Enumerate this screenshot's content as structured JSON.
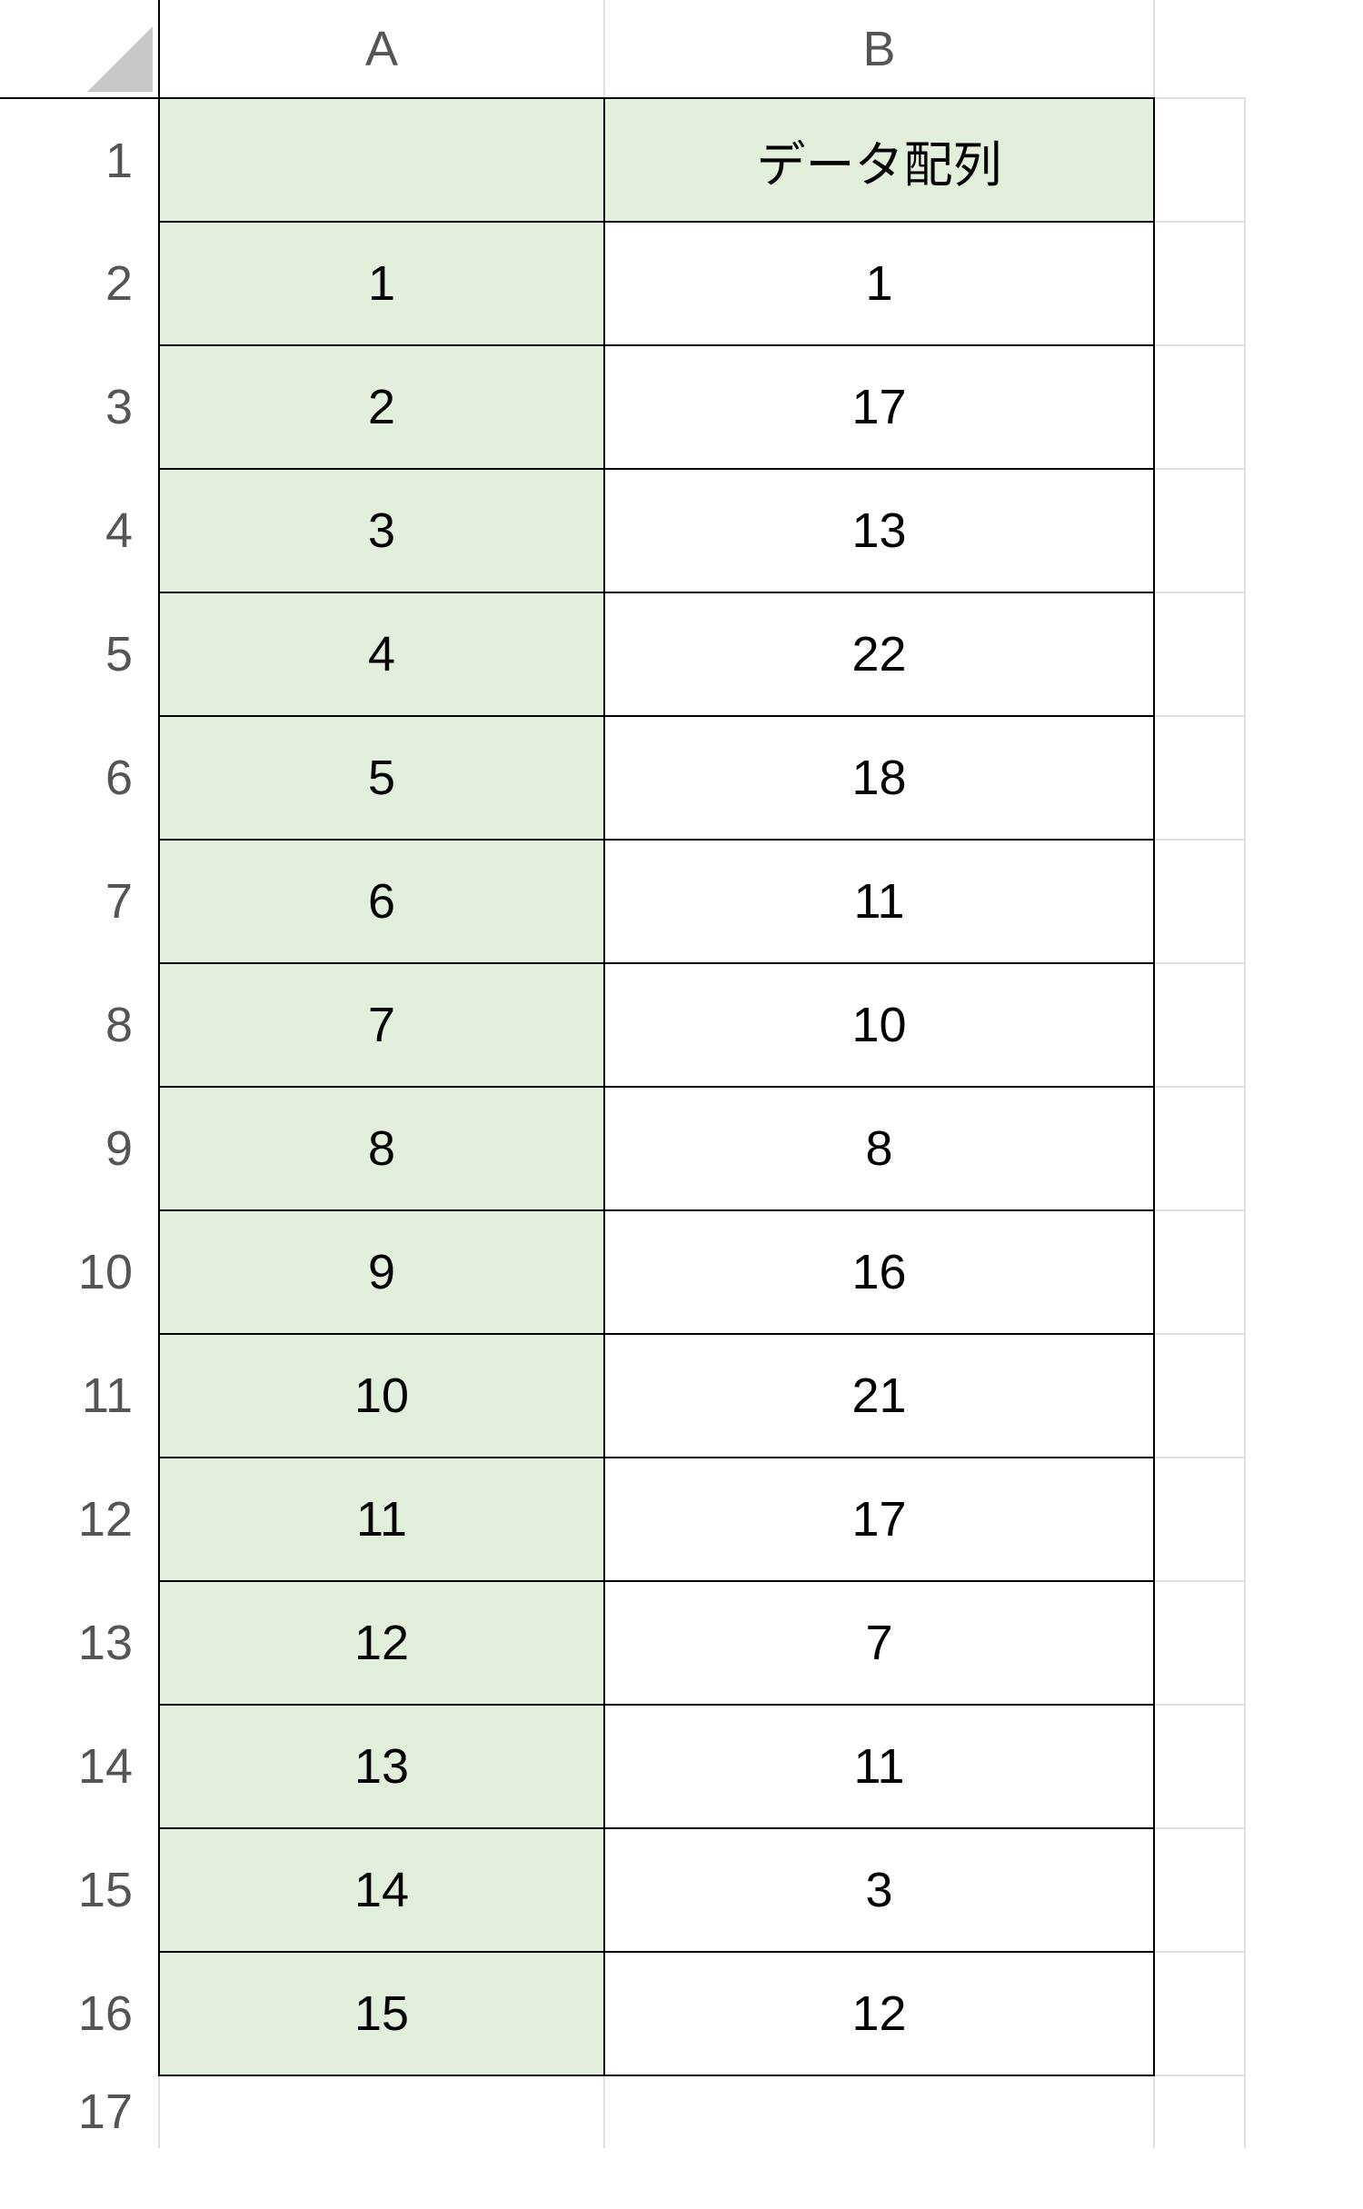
{
  "columns": {
    "A": "A",
    "B": "B"
  },
  "rowHeaders": [
    "1",
    "2",
    "3",
    "4",
    "5",
    "6",
    "7",
    "8",
    "9",
    "10",
    "11",
    "12",
    "13",
    "14",
    "15",
    "16",
    "17"
  ],
  "headerRow": {
    "A": "",
    "B": "データ配列"
  },
  "rows": [
    {
      "A": "1",
      "B": "1"
    },
    {
      "A": "2",
      "B": "17"
    },
    {
      "A": "3",
      "B": "13"
    },
    {
      "A": "4",
      "B": "22"
    },
    {
      "A": "5",
      "B": "18"
    },
    {
      "A": "6",
      "B": "11"
    },
    {
      "A": "7",
      "B": "10"
    },
    {
      "A": "8",
      "B": "8"
    },
    {
      "A": "9",
      "B": "16"
    },
    {
      "A": "10",
      "B": "21"
    },
    {
      "A": "11",
      "B": "17"
    },
    {
      "A": "12",
      "B": "7"
    },
    {
      "A": "13",
      "B": "11"
    },
    {
      "A": "14",
      "B": "3"
    },
    {
      "A": "15",
      "B": "12"
    }
  ]
}
